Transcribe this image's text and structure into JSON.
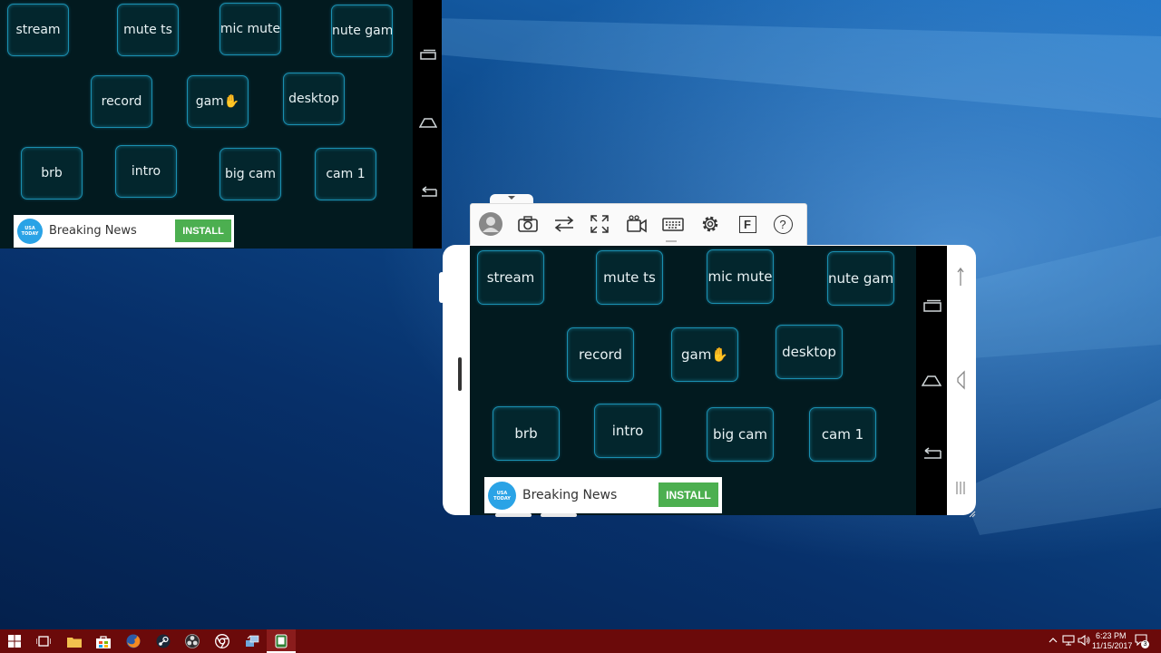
{
  "buttons": {
    "stream": "stream",
    "mute_ts": "mute ts",
    "mic_mute": "mic mute",
    "mute_game": "nute gam‹",
    "record": "record",
    "game": "gam",
    "desktop": "desktop",
    "brb": "brb",
    "intro": "intro",
    "big_cam": "big cam",
    "cam1": "cam 1"
  },
  "ad": {
    "logo_text": "USA TODAY",
    "title": "Breaking News",
    "install": "INSTALL"
  },
  "toolbar": {
    "icons": [
      "avatar-icon",
      "camera-icon",
      "swap-icon",
      "fullscreen-icon",
      "record-video-icon",
      "keyboard-icon",
      "settings-icon",
      "f-icon",
      "help-icon"
    ],
    "f_label": "F",
    "help_label": "?"
  },
  "taskbar": {
    "apps": [
      "windows-start",
      "task-view",
      "file-explorer",
      "store",
      "firefox",
      "steam",
      "obs",
      "chrome",
      "remote-desktop",
      "phone-app"
    ],
    "time": "6:23 PM",
    "date": "11/15/2017",
    "notification_count": "3"
  },
  "colors": {
    "button_border": "#1a8fb0",
    "panel_bg": "#021a1f",
    "install_green": "#4caf50",
    "taskbar": "#6b0a0a"
  }
}
